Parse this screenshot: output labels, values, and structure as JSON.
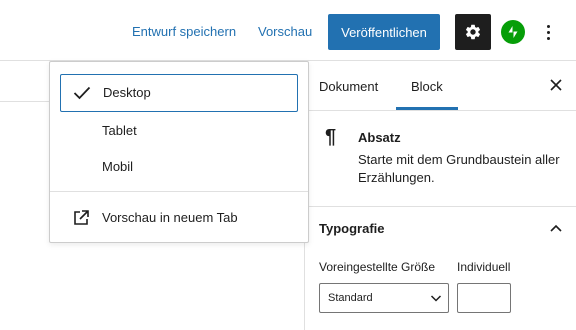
{
  "header": {
    "save_draft_label": "Entwurf speichern",
    "preview_label": "Vorschau",
    "publish_label": "Veröffentlichen",
    "icons": {
      "settings": "gear-icon",
      "jetpack": "jetpack-bolt-icon",
      "more": "vertical-ellipsis-icon"
    },
    "accent_color": "#2271b1"
  },
  "preview_menu": {
    "items": [
      {
        "label": "Desktop",
        "selected": true,
        "icon": "check-icon"
      },
      {
        "label": "Tablet",
        "selected": false
      },
      {
        "label": "Mobil",
        "selected": false
      }
    ],
    "new_tab": {
      "label": "Vorschau in neuem Tab",
      "icon": "external-link-icon"
    }
  },
  "sidebar": {
    "tabs": [
      {
        "label": "Dokument",
        "active": false
      },
      {
        "label": "Block",
        "active": true
      }
    ],
    "close_icon": "close-icon",
    "block": {
      "icon": "paragraph-icon",
      "title": "Absatz",
      "description": "Starte mit dem Grundbaustein aller Erzählungen."
    },
    "typography": {
      "title": "Typografie",
      "preset_label": "Voreingestellte Größe",
      "custom_label": "Individuell",
      "preset_value": "Standard",
      "custom_value": ""
    }
  }
}
